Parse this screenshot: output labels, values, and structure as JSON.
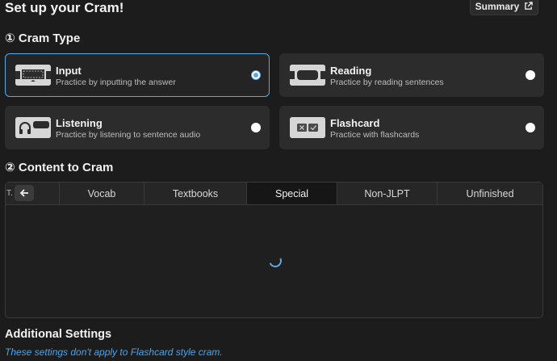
{
  "header": {
    "title": "Set up your Cram!",
    "summary_label": "Summary"
  },
  "cram_type": {
    "title": "① Cram Type",
    "options": [
      {
        "name": "Input",
        "desc": "Practice by inputting the answer",
        "selected": true
      },
      {
        "name": "Reading",
        "desc": "Practice by reading sentences",
        "selected": false
      },
      {
        "name": "Listening",
        "desc": "Practice by listening to sentence audio",
        "selected": false
      },
      {
        "name": "Flashcard",
        "desc": "Practice with flashcards",
        "selected": false
      }
    ]
  },
  "content": {
    "title": "② Content to Cram",
    "tabs": [
      {
        "label": "T.",
        "active": false
      },
      {
        "label": "Vocab",
        "active": false
      },
      {
        "label": "Textbooks",
        "active": false
      },
      {
        "label": "Special",
        "active": true
      },
      {
        "label": "Non-JLPT",
        "active": false
      },
      {
        "label": "Unfinished",
        "active": false
      }
    ],
    "loading": true
  },
  "additional": {
    "title": "Additional Settings",
    "note": "These settings don't apply to Flashcard style cram."
  },
  "colors": {
    "accent": "#58a9e6",
    "background": "#1c1c1c",
    "card": "#2c2c2c"
  }
}
